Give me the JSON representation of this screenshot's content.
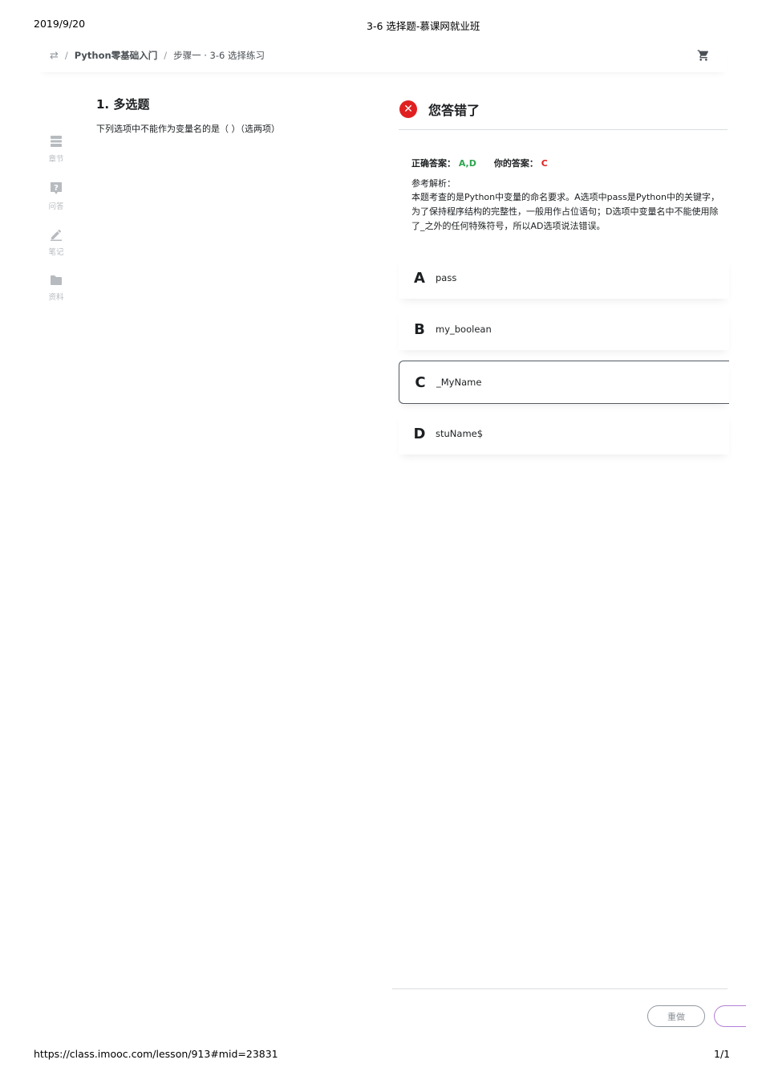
{
  "print_header": {
    "date": "2019/9/20",
    "title": "3-6 选择题-慕课网就业班"
  },
  "print_footer": {
    "url": "https://class.imooc.com/lesson/913#mid=23831",
    "page": "1/1"
  },
  "breadcrumb": {
    "course": "Python零基础入门",
    "step": "步骤一 · 3-6 选择练习",
    "separator": "/"
  },
  "sidebar": {
    "items": [
      {
        "label": "章节",
        "icon": "chapters-icon"
      },
      {
        "label": "问答",
        "icon": "question-icon"
      },
      {
        "label": "笔记",
        "icon": "pencil-icon"
      },
      {
        "label": "资料",
        "icon": "folder-icon"
      }
    ]
  },
  "question": {
    "title": "1. 多选题",
    "text": "下列选项中不能作为变量名的是（ ）（选两项）"
  },
  "result": {
    "title": "您答错了",
    "correct_label": "正确答案：",
    "correct_value": "A,D",
    "yours_label": "你的答案：",
    "yours_value": "C",
    "explain_label": "参考解析：",
    "explain_text": "本题考查的是Python中变量的命名要求。A选项中pass是Python中的关键字，为了保持程序结构的完整性，一般用作占位语句；D选项中变量名中不能使用除了_之外的任何特殊符号，所以AD选项说法错误。"
  },
  "options": [
    {
      "letter": "A",
      "text": "pass"
    },
    {
      "letter": "B",
      "text": "my_boolean"
    },
    {
      "letter": "C",
      "text": "_MyName"
    },
    {
      "letter": "D",
      "text": "stuName$"
    }
  ],
  "actions": {
    "redo": "重做"
  },
  "colors": {
    "correct": "#2ea44f",
    "wrong": "#e02020",
    "next_border": "#b37fd6"
  }
}
